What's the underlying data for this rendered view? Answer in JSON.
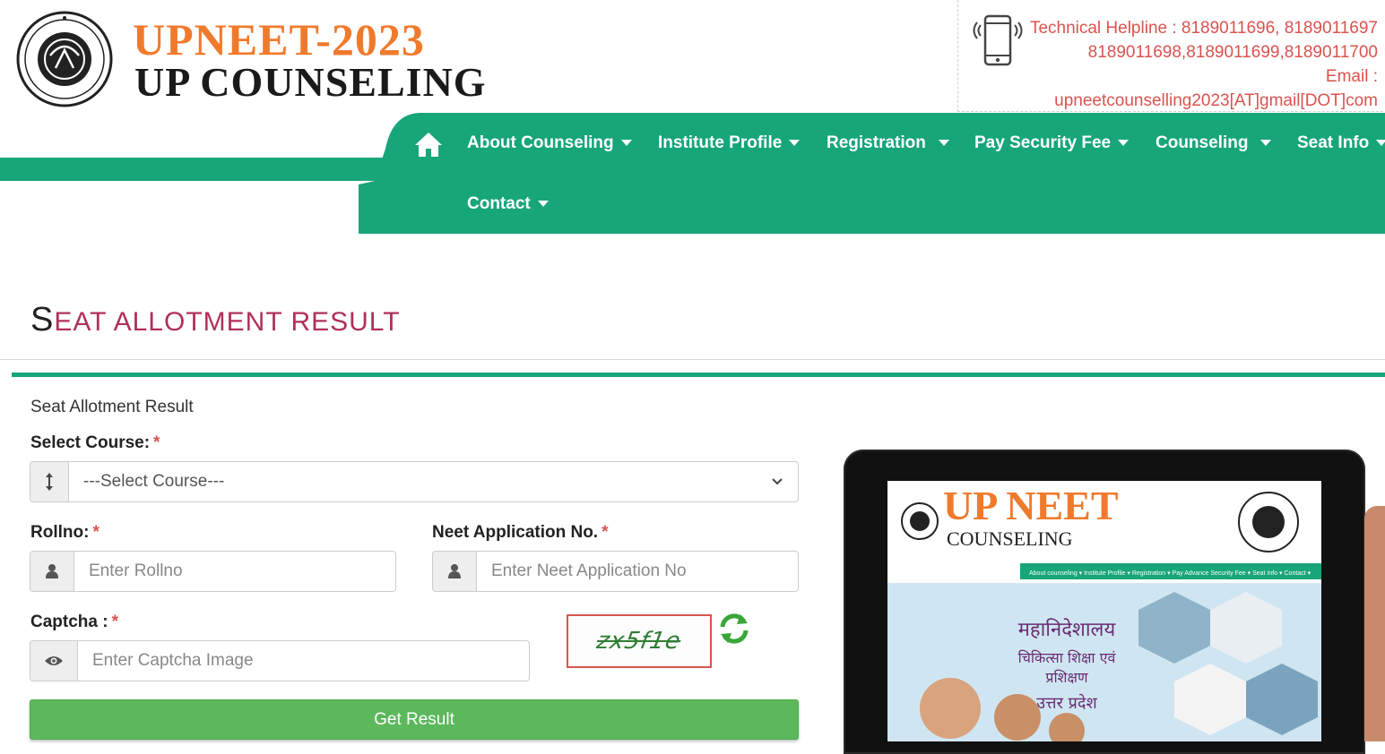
{
  "header": {
    "brand_title": "UPNEET-2023",
    "brand_subtitle": "UP COUNSELING",
    "seal_ring_text": "GOVERNMENT OF UTTAR PRADESH",
    "helpline_line1": "Technical Helpline : 8189011696, 8189011697",
    "helpline_line2": "8189011698,8189011699,8189011700",
    "email_label": "Email :",
    "email_value": "upneetcounselling2023[AT]gmail[DOT]com"
  },
  "nav": {
    "items": [
      {
        "label": "About Counseling"
      },
      {
        "label": "Institute Profile"
      },
      {
        "label": "Registration"
      },
      {
        "label": "Pay Security Fee"
      },
      {
        "label": "Counseling"
      },
      {
        "label": "Seat Info"
      },
      {
        "label": "Contact"
      }
    ]
  },
  "page": {
    "title_first": "S",
    "title_rest": "EAT ALLOTMENT RESULT",
    "panel_heading": "Seat Allotment Result"
  },
  "form": {
    "course_label": "Select Course:",
    "course_value": "---Select Course---",
    "rollno_label": "Rollno:",
    "rollno_placeholder": "Enter Rollno",
    "neet_label": "Neet Application No.",
    "neet_placeholder": "Enter Neet Application No",
    "captcha_label": "Captcha :",
    "captcha_placeholder": "Enter Captcha Image",
    "captcha_text": "zx5f1e",
    "required_mark": "*",
    "submit_label": "Get Result"
  },
  "promo": {
    "title": "UP NEET",
    "subtitle": "COUNSELING",
    "nav_text": "About counseling ▾   Institute Profile ▾   Registration ▾   Pay Advance Security Fee ▾   Seat Info ▾   Contact ▾",
    "hindi_line1": "महानिदेशालय",
    "hindi_line2": "चिकित्सा शिक्षा एवं प्रशिक्षण",
    "hindi_line3": "उत्तर प्रदेश"
  },
  "colors": {
    "brand_green": "#17a57a",
    "brand_orange": "#f07a2c",
    "title_magenta": "#b0305a",
    "helpline_red": "#d9534f",
    "button_green": "#5cb85c"
  }
}
